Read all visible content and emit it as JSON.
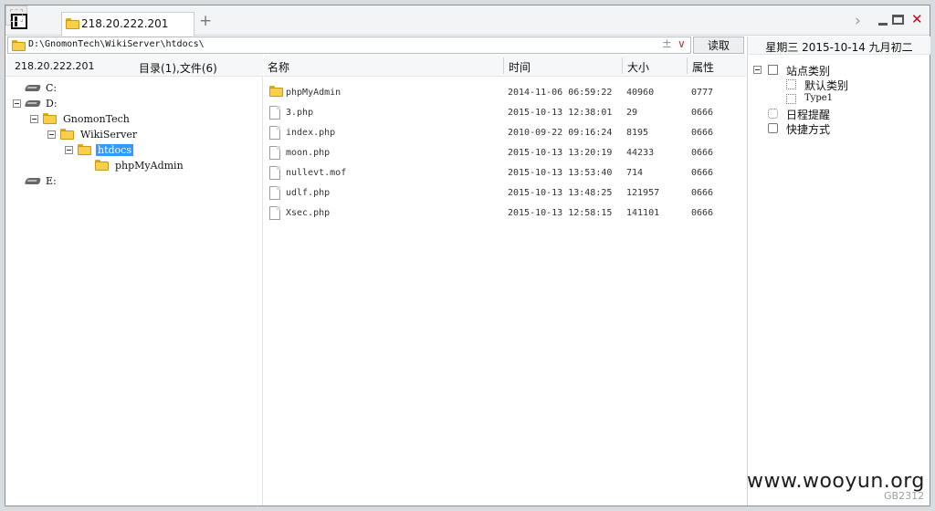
{
  "tabbar": {
    "tab_label": "218.20.222.201",
    "new_tab": "+",
    "forward": "›"
  },
  "addressbar": {
    "path": "D:\\GnomonTech\\WikiServer\\htdocs\\",
    "plus": "±",
    "dropdown": "∨",
    "read_button": "读取"
  },
  "left": {
    "host": "218.20.222.201",
    "summary": "目录(1),文件(6)",
    "tree": {
      "c": "C:",
      "d": "D:",
      "gnomontech": "GnomonTech",
      "wikiserver": "WikiServer",
      "htdocs": "htdocs",
      "phpmyadmin": "phpMyAdmin",
      "e": "E:"
    }
  },
  "filelist": {
    "columns": {
      "name": "名称",
      "time": "时间",
      "size": "大小",
      "attr": "属性"
    },
    "rows": [
      {
        "name": "phpMyAdmin",
        "time": "2014-11-06 06:59:22",
        "size": "40960",
        "attr": "0777",
        "type": "folder"
      },
      {
        "name": "3.php",
        "time": "2015-10-13 12:38:01",
        "size": "29",
        "attr": "0666",
        "type": "file"
      },
      {
        "name": "index.php",
        "time": "2010-09-22 09:16:24",
        "size": "8195",
        "attr": "0666",
        "type": "file"
      },
      {
        "name": "moon.php",
        "time": "2015-10-13 13:20:19",
        "size": "44233",
        "attr": "0666",
        "type": "file"
      },
      {
        "name": "nullevt.mof",
        "time": "2015-10-13 13:53:40",
        "size": "714",
        "attr": "0666",
        "type": "file"
      },
      {
        "name": "udlf.php",
        "time": "2015-10-13 13:48:25",
        "size": "121957",
        "attr": "0666",
        "type": "file"
      },
      {
        "name": "Xsec.php",
        "time": "2015-10-13 12:58:15",
        "size": "141101",
        "attr": "0666",
        "type": "file"
      }
    ]
  },
  "right": {
    "date_line": "星期三  2015-10-14  九月初二",
    "site_category": "站点类别",
    "default_category": "默认类别",
    "type1": "Type1",
    "schedule": "日程提醒",
    "shortcuts": "快捷方式"
  },
  "watermark": "www.wooyun.org",
  "gb_label": "GB2312",
  "colors": {
    "selection": "#3399ff",
    "close": "#d0021b",
    "folder": "#f7cf4a"
  }
}
